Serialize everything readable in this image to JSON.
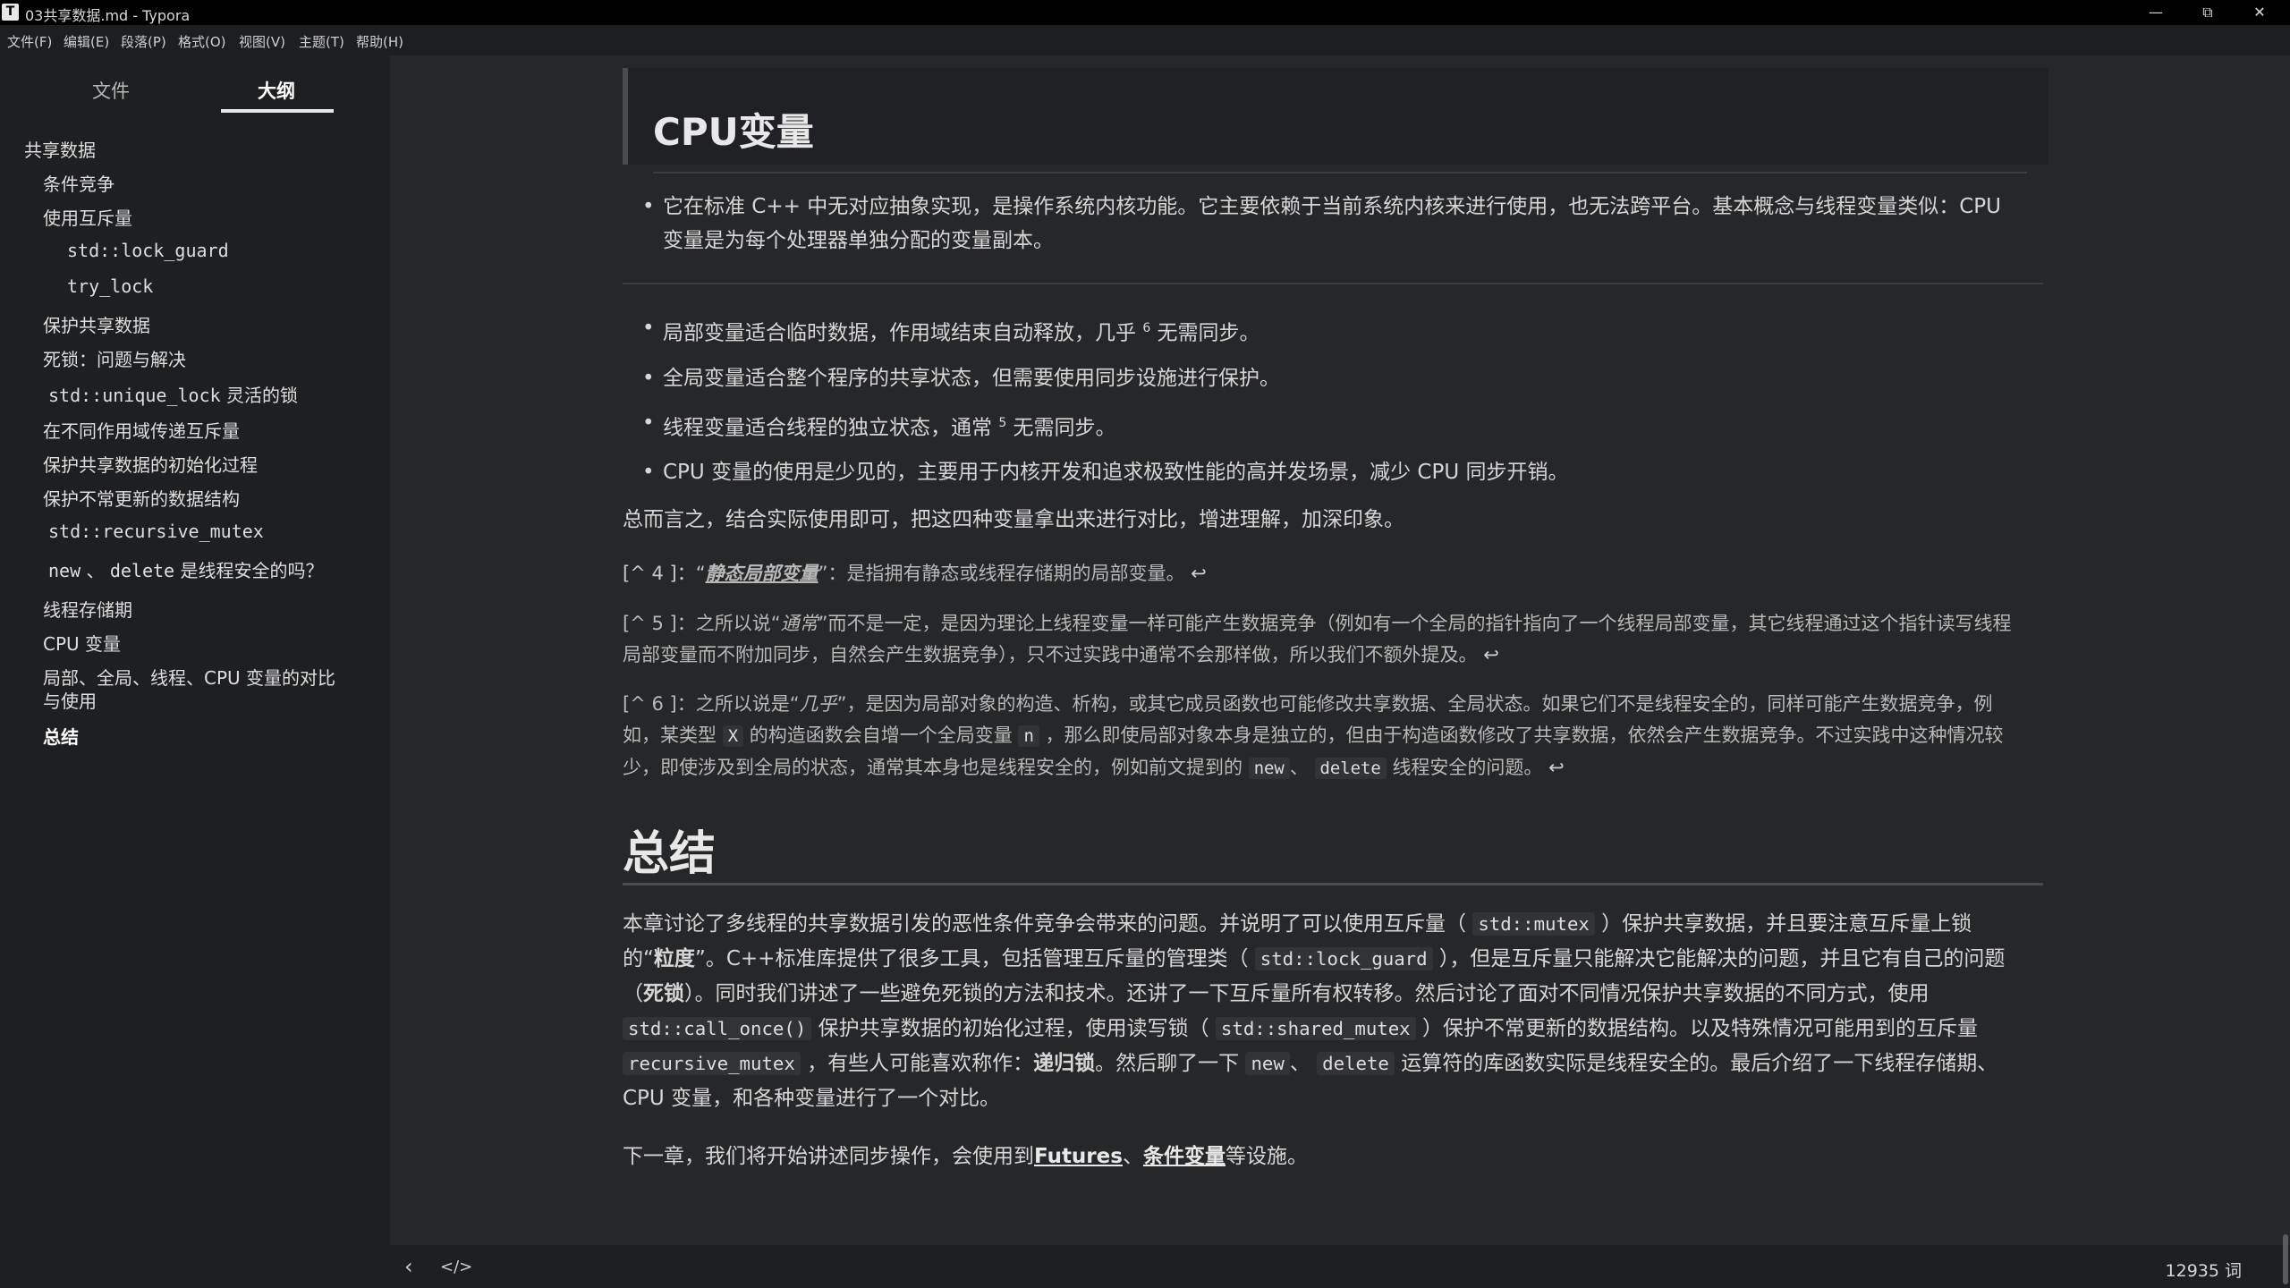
{
  "window": {
    "app_icon": "T",
    "title": "03共享数据.md - Typora",
    "min": "—",
    "max": "⧉",
    "close": "✕"
  },
  "menu": [
    "文件(F)",
    "编辑(E)",
    "段落(P)",
    "格式(O)",
    "视图(V)",
    "主题(T)",
    "帮助(H)"
  ],
  "sidebar": {
    "tabs": [
      "文件",
      "大纲"
    ],
    "outline": [
      "共享数据",
      "条件竞争",
      "使用互斥量",
      "std::lock_guard",
      "try_lock",
      "保护共享数据",
      "死锁：问题与解决",
      "std::unique_lock",
      "灵活的锁",
      "在不同作用域传递互斥量",
      "保护共享数据的初始化过程",
      "保护不常更新的数据结构",
      "std::recursive_mutex",
      "new",
      "、",
      "delete",
      "是线程安全的吗？",
      "线程存储期",
      "CPU 变量",
      "局部、全局、线程、CPU 变量的对比",
      "与使用",
      "总结"
    ]
  },
  "doc": {
    "h2": "CPU变量",
    "b0": [
      "它在标准 C++ 中无对应抽象实现，是操作系统内核功能。它主要依赖于当前系统内核来进行使用，也无法跨平台。基本概念与线程变量类似：CPU",
      "变量是为每个处理器单独分配的变量副本。"
    ],
    "bullets": [
      [
        "局部变量适合临时数据，作用域结束自动释放，几乎",
        "6",
        "无需同步。"
      ],
      [
        "全局变量适合整个程序的共享状态，但需要使用同步设施进行保护。"
      ],
      [
        "线程变量适合线程的独立状态，通常",
        "5",
        "无需同步。"
      ],
      [
        "CPU 变量的使用是少见的，主要用于内核开发和追求极致性能的高并发场景，减少 CPU 同步开销。"
      ]
    ],
    "summary_line": "总而言之，结合实际使用即可，把这四种变量拿出来进行对比，增进理解，加深印象。",
    "fn4": [
      "[^ 4 ]：“",
      "静态局部变量",
      "”：是指拥有静态或线程存储期的局部变量。",
      "↩"
    ],
    "fn5": [
      "[^ 5 ]：之所以说“",
      "通常",
      "”而不是一定，是因为理论上线程变量一样可能产生数据竞争（例如有一个全局的指针指向了一个线程局部变量，其它线程通过这个指针读写线程",
      "局部变量而不附加同步，自然会产生数据竞争），只不过实践中通常不会那样做，所以我们不额外提及。",
      "↩"
    ],
    "fn6": [
      "[^ 6 ]：之所以说是“",
      "几乎",
      "”，是因为局部对象的构造、析构，或其它成员函数也可能修改共享数据、全局状态。如果它们不是线程安全的，同样可能产生数据竞争，例",
      "如，某类型",
      "X",
      "的构造函数会自增一个全局变量",
      "n",
      "，那么即使局部对象本身是独立的，但由于构造函数修改了共享数据，依然会产生数据竞争。不过实践中这种情况较",
      "少，即使涉及到全局的状态，通常其本身也是线程安全的，例如前文提到的",
      "new",
      "、",
      "delete",
      "线程安全的问题。",
      "↩"
    ],
    "h1": "总结",
    "p1": [
      "本章讨论了多线程的共享数据引发的恶性条件竞争会带来的问题。并说明了可以使用互斥量（",
      "std::mutex",
      "）保护共享数据，并且要注意互斥量上锁",
      "的“",
      "粒度",
      "”。C++标准库提供了很多工具，包括管理互斥量的管理类（",
      "std::lock_guard",
      "），但是互斥量只能解决它能解决的问题，并且它有自己的问题",
      "（",
      "死锁",
      "）。同时我们讲述了一些避免死锁的方法和技术。还讲了一下互斥量所有权转移。然后讨论了面对不同情况保护共享数据的不同方式，使用",
      "std::call_once()",
      "保护共享数据的初始化过程，使用读写锁（",
      "std::shared_mutex",
      "）保护不常更新的数据结构。以及特殊情况可能用到的互斥量",
      "recursive_mutex",
      "，有些人可能喜欢称作：",
      "递归锁",
      "。然后聊了一下",
      "new",
      "、",
      "delete",
      "运算符的库函数实际是线程安全的。最后介绍了一下线程存储期、",
      "CPU 变量，和各种变量进行了一个对比。"
    ],
    "p2": [
      "下一章，我们将开始讲述同步操作，会使用到",
      "Futures",
      "、",
      "条件变量",
      "等设施。"
    ]
  },
  "status": {
    "back": "‹",
    "source": "</>",
    "word_count": "12935 词"
  }
}
